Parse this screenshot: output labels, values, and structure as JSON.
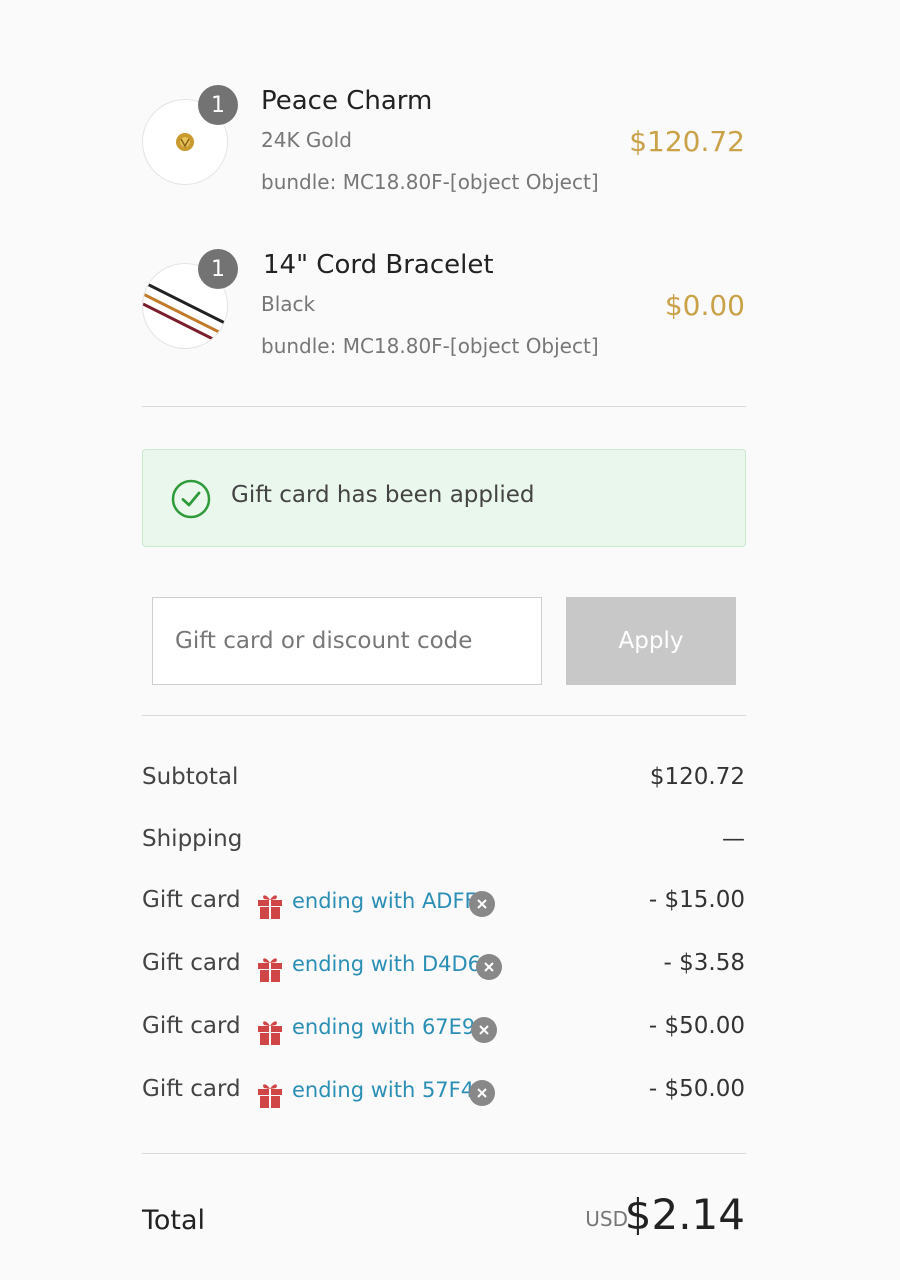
{
  "items": [
    {
      "quantity": "1",
      "name": "Peace Charm",
      "variant": "24K Gold",
      "bundle": "bundle: MC18.80F-[object Object]",
      "price": "$120.72",
      "image_icon": "peace-charm-image"
    },
    {
      "quantity": "1",
      "name": "14\" Cord Bracelet",
      "variant": "Black",
      "bundle": "bundle: MC18.80F-[object Object]",
      "price": "$0.00",
      "image_icon": "cord-bracelet-image"
    }
  ],
  "notice": {
    "text": "Gift card has been applied",
    "icon": "check-circle-icon"
  },
  "discount": {
    "placeholder": "Gift card or discount code",
    "value": "",
    "apply_label": "Apply"
  },
  "summary": {
    "subtotal_label": "Subtotal",
    "subtotal_value": "$120.72",
    "shipping_label": "Shipping",
    "shipping_value": "—",
    "gift_cards": [
      {
        "label": "Gift card",
        "code": "ending with ADFF",
        "amount": "- $15.00"
      },
      {
        "label": "Gift card",
        "code": "ending with D4D6",
        "amount": "- $3.58"
      },
      {
        "label": "Gift card",
        "code": "ending with 67E9",
        "amount": "- $50.00"
      },
      {
        "label": "Gift card",
        "code": "ending with 57F4",
        "amount": "- $50.00"
      }
    ],
    "total_label": "Total",
    "currency": "USD",
    "total_value": "$2.14"
  },
  "colors": {
    "price": "#c9a24a",
    "link": "#2b8fb5",
    "success": "#2e9a3a",
    "gift_icon": "#d04545"
  }
}
